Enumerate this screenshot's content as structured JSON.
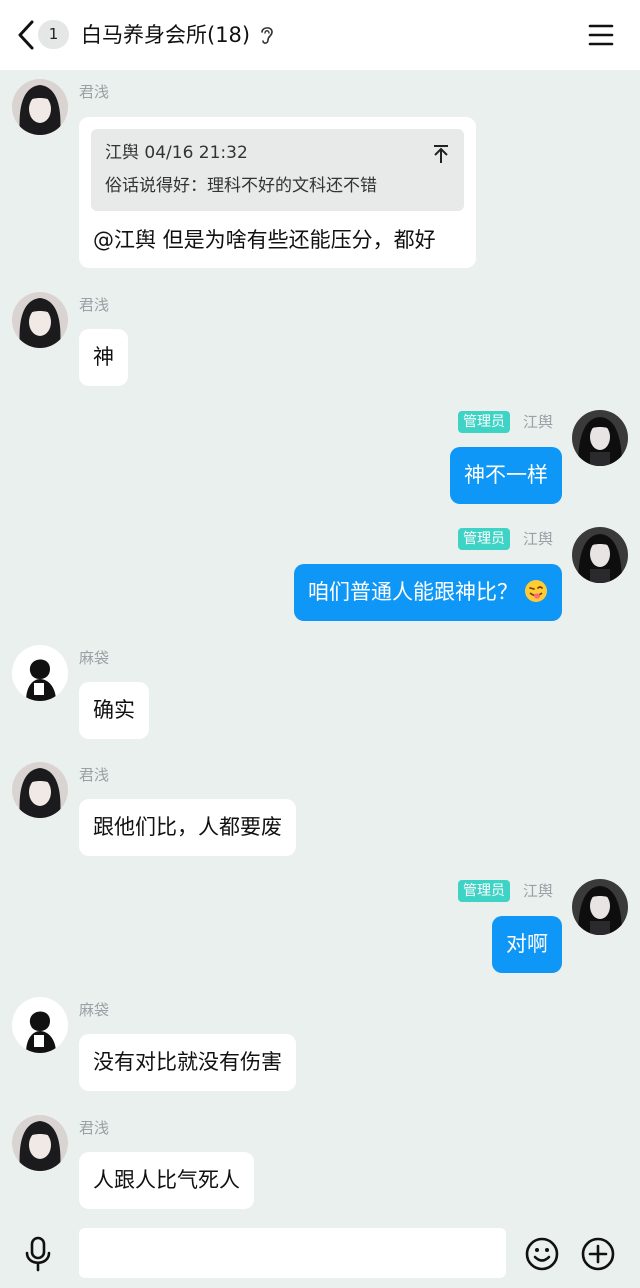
{
  "header": {
    "back_count": "1",
    "title": "白马养身会所(18)"
  },
  "messages": [
    {
      "sender": "君浅",
      "quote": {
        "author_time": "江舆 04/16 21:32",
        "text": "俗话说得好：理科不好的文科还不错"
      },
      "text": "@江舆 但是为啥有些还能压分，都好"
    },
    {
      "sender": "君浅",
      "text": "神"
    },
    {
      "sender": "江舆",
      "badge": "管理员",
      "text": "神不一样",
      "mine": true
    },
    {
      "sender": "江舆",
      "badge": "管理员",
      "text": "咱们普通人能跟神比？",
      "mine": true,
      "emoji": "tongue-out-emoji"
    },
    {
      "sender": "麻袋",
      "text": "确实"
    },
    {
      "sender": "君浅",
      "text": "跟他们比，人都要废"
    },
    {
      "sender": "江舆",
      "badge": "管理员",
      "text": "对啊",
      "mine": true
    },
    {
      "sender": "麻袋",
      "text": "没有对比就没有伤害"
    },
    {
      "sender": "君浅",
      "text": "人跟人比气死人"
    }
  ],
  "input": {
    "value": "",
    "placeholder": ""
  },
  "icons": {
    "back": "chevron-left-icon",
    "ear": "ear-icon",
    "menu": "menu-icon",
    "mic": "microphone-icon",
    "emoji": "smile-icon",
    "plus": "plus-icon"
  },
  "colors": {
    "background": "#eaf0ee",
    "my_bubble": "#0e97f6",
    "admin_badge": "#3fd3c6"
  }
}
